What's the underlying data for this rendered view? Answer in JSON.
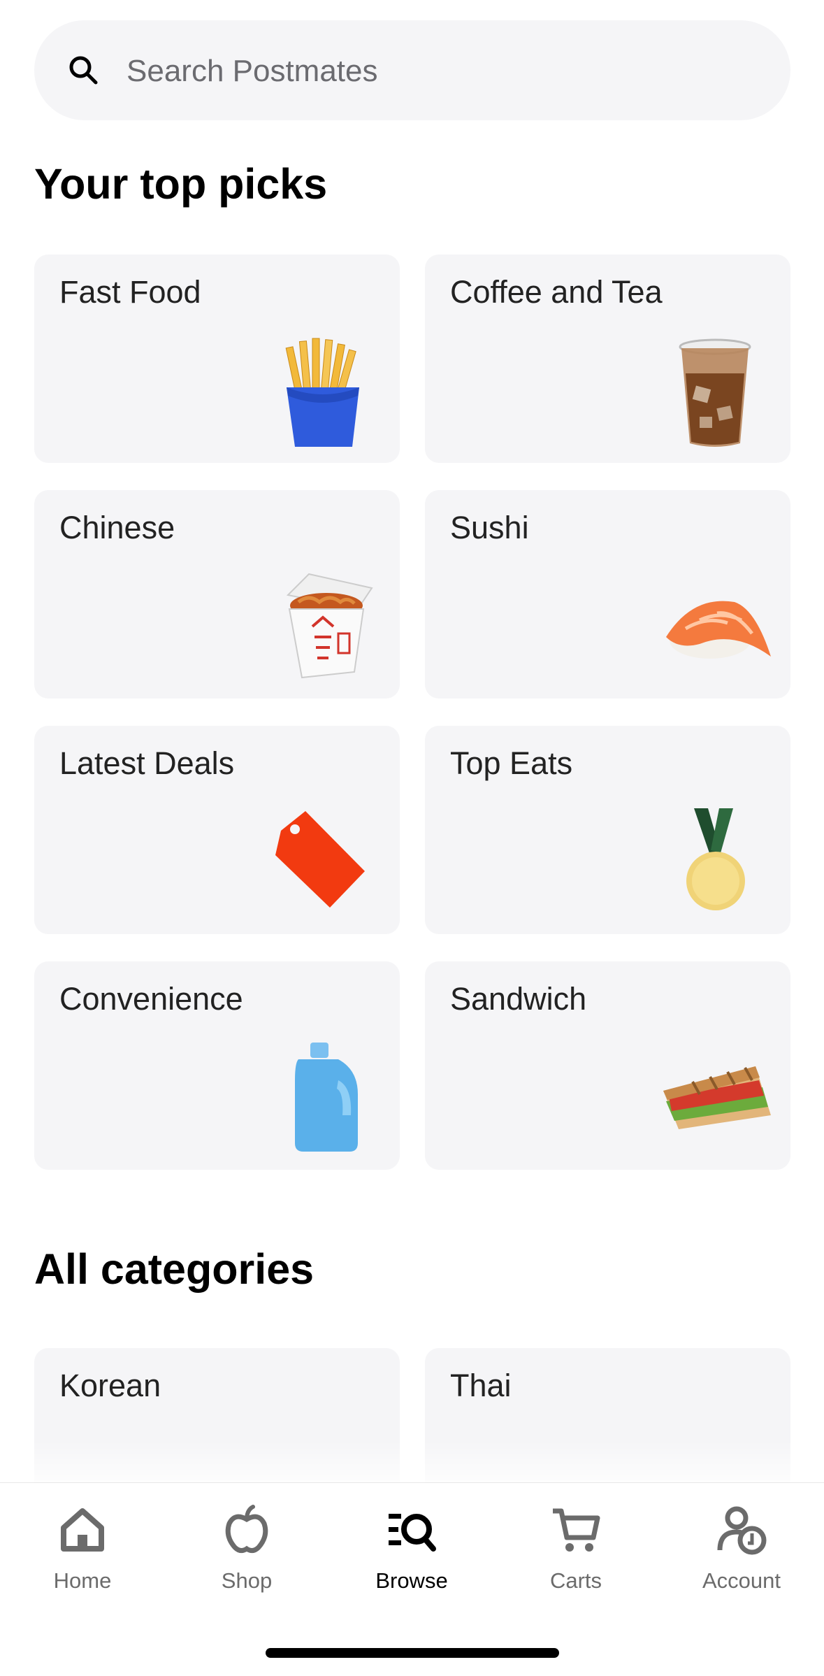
{
  "search": {
    "placeholder": "Search Postmates"
  },
  "sections": {
    "top_picks": "Your top picks",
    "all_categories": "All categories"
  },
  "top_picks": [
    {
      "label": "Fast Food",
      "icon": "fries-image"
    },
    {
      "label": "Coffee and Tea",
      "icon": "iced-coffee-image"
    },
    {
      "label": "Chinese",
      "icon": "takeout-box-image"
    },
    {
      "label": "Sushi",
      "icon": "salmon-nigiri-image"
    },
    {
      "label": "Latest Deals",
      "icon": "price-tag-image"
    },
    {
      "label": "Top Eats",
      "icon": "medal-image"
    },
    {
      "label": "Convenience",
      "icon": "detergent-bottle-image"
    },
    {
      "label": "Sandwich",
      "icon": "sandwich-image"
    }
  ],
  "all_categories": [
    {
      "label": "Korean",
      "icon": "bibimbap-image"
    },
    {
      "label": "Thai",
      "icon": "thai-dish-image"
    }
  ],
  "tabbar": {
    "home": "Home",
    "shop": "Shop",
    "browse": "Browse",
    "carts": "Carts",
    "account": "Account"
  },
  "colors": {
    "card_bg": "#f5f5f7",
    "tag_red": "#f23a10",
    "fries_blue": "#2f5bdc",
    "active_tab": "#000000",
    "inactive_tab": "#6b6b6b"
  }
}
